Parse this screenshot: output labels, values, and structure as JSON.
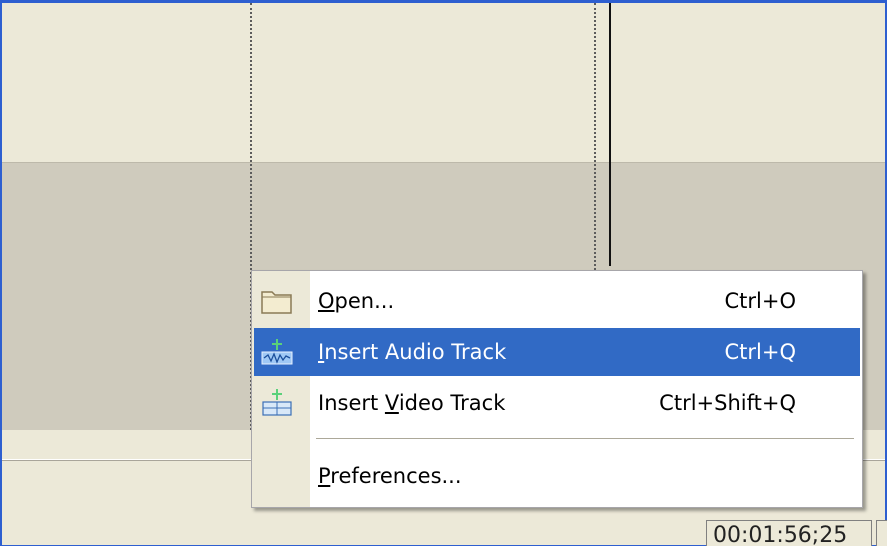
{
  "timeline": {
    "time_display": "00:01:56;25"
  },
  "context_menu": {
    "items": [
      {
        "label_mnemonic": "O",
        "label_rest": "pen...",
        "shortcut": "Ctrl+O",
        "icon": "folder-icon"
      },
      {
        "label_mnemonic": "I",
        "label_rest": "nsert Audio Track",
        "shortcut": "Ctrl+Q",
        "icon": "audio-track-icon",
        "highlighted": true
      },
      {
        "label_prefix": "Insert ",
        "label_mnemonic": "V",
        "label_rest": "ideo Track",
        "shortcut": "Ctrl+Shift+Q",
        "icon": "video-track-icon"
      },
      {
        "label_mnemonic": "P",
        "label_rest": "references...",
        "shortcut": ""
      }
    ]
  },
  "colors": {
    "highlight": "#316ac5",
    "window_border": "#2e5fd0",
    "gutter": "#ece9d8"
  }
}
